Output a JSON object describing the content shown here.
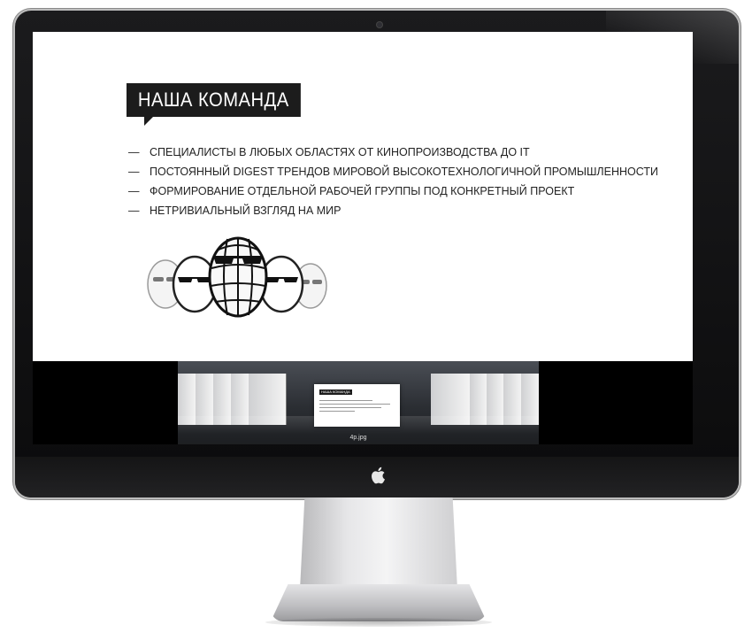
{
  "slide": {
    "title": "НАША КОМАНДА",
    "bullets": [
      "СПЕЦИАЛИСТЫ В ЛЮБЫХ ОБЛАСТЯХ ОТ КИНОПРОИЗВОДСТВА ДО IT",
      "ПОСТОЯННЫЙ DIGEST ТРЕНДОВ МИРОВОЙ ВЫСОКОТЕХНОЛОГИЧНОЙ ПРОМЫШЛЕННОСТИ",
      "ФОРМИРОВАНИЕ ОТДЕЛЬНОЙ РАБОЧЕЙ ГРУППЫ ПОД КОНКРЕТНЫЙ ПРОЕКТ",
      "НЕТРИВИАЛЬНЫЙ ВЗГЛЯД НА МИР"
    ],
    "bullet_marker": "—"
  },
  "coverflow": {
    "selected_file": "4p.jpg",
    "center_thumb_title": "НАША КОМАНДА"
  },
  "icons": {
    "brand": "apple-icon",
    "camera": "camera-icon",
    "illustration": "egg-characters-illustration"
  },
  "colors": {
    "bezel": "#111112",
    "title_bg": "#1c1c1c",
    "slide_bg": "#ffffff",
    "text": "#222222"
  }
}
